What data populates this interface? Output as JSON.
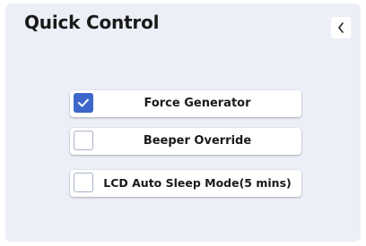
{
  "header": {
    "title": "Quick Control",
    "collapse_icon": "chevron-left-icon"
  },
  "options": [
    {
      "label": "Force Generator",
      "checked": true
    },
    {
      "label": "Beeper Override",
      "checked": false
    },
    {
      "label": "LCD Auto Sleep Mode(5 mins)",
      "checked": false
    }
  ],
  "colors": {
    "panel_background": "#eceff7",
    "checkbox_accent": "#3c66c9",
    "checkbox_border": "#a9b3c9",
    "text": "#1a1a1a"
  }
}
